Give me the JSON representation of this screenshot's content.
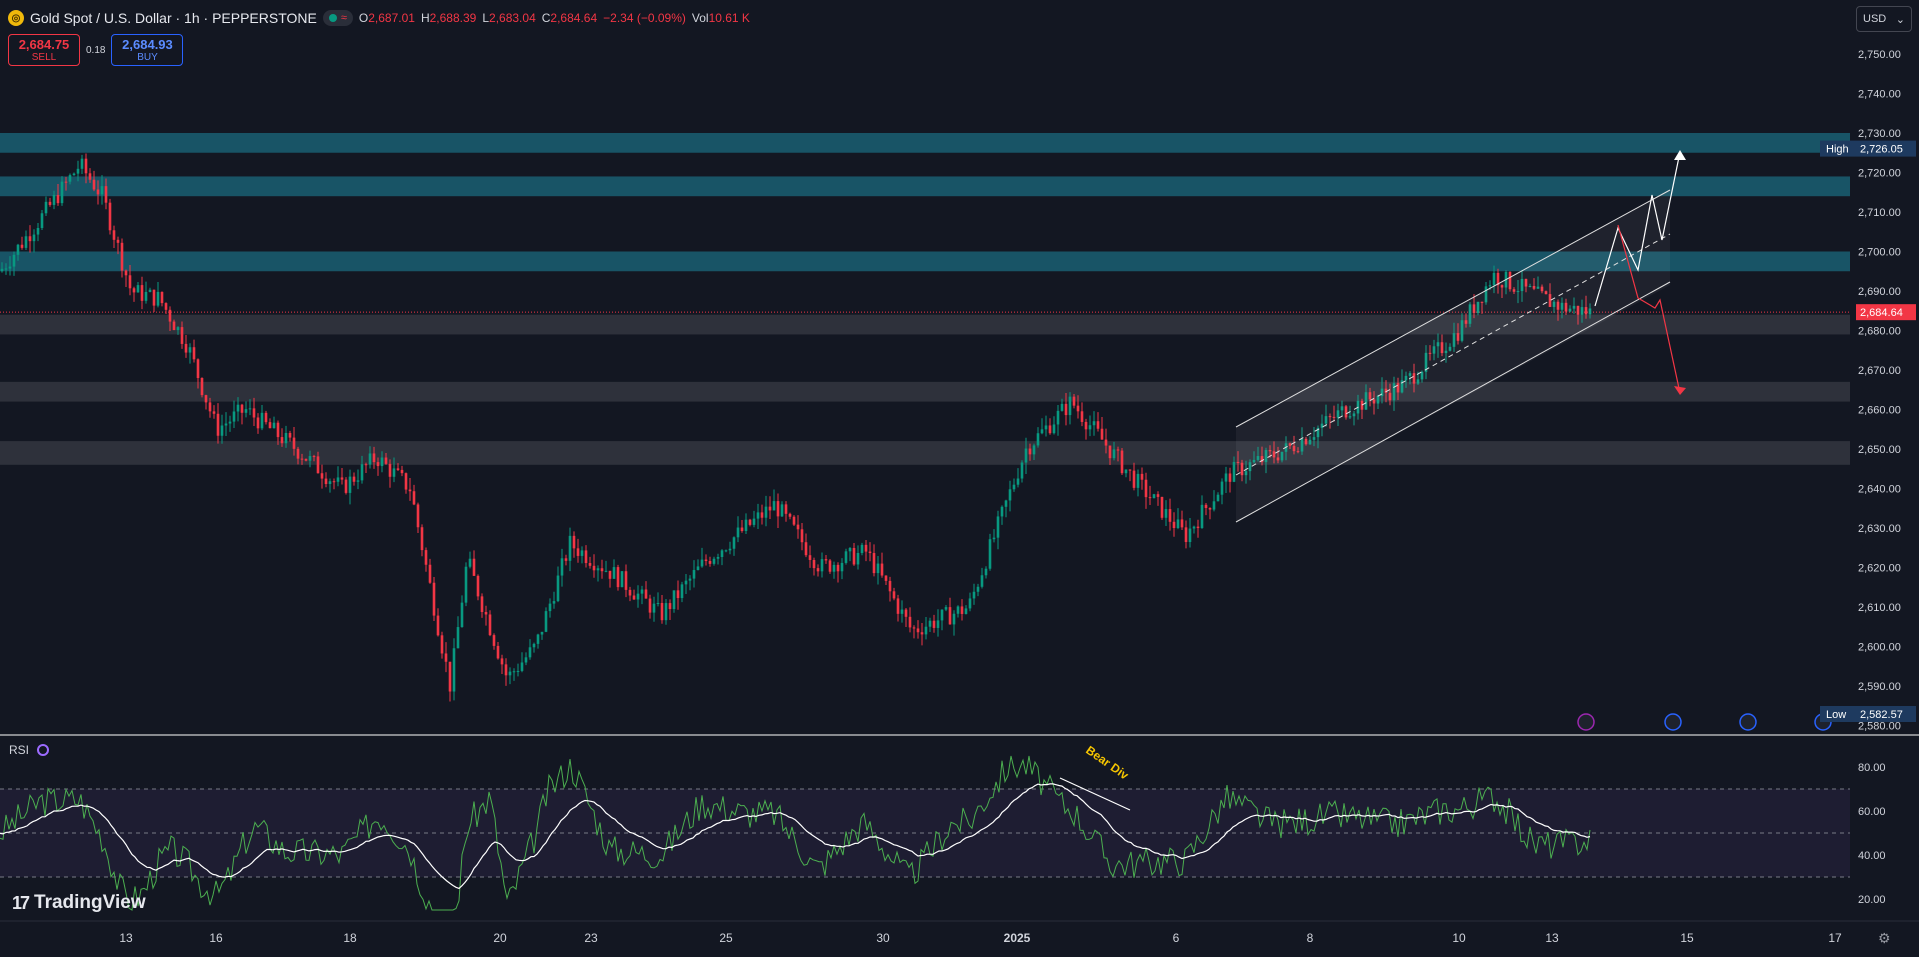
{
  "header": {
    "symbol_icon": "gold-coin-icon",
    "title": "Gold Spot / U.S. Dollar · 1h · PEPPERSTONE",
    "status_icon": "market-open-dot-icon",
    "wave_icon": "≈",
    "open_label": "O",
    "open": "2,687.01",
    "high_label": "H",
    "high": "2,688.39",
    "low_label": "L",
    "low": "2,683.04",
    "close_label": "C",
    "close": "2,684.64",
    "change": "−2.34 (−0.09%)",
    "vol_label": "Vol",
    "vol": "10.61 K"
  },
  "trade": {
    "sell_price": "2,684.75",
    "sell_label": "SELL",
    "spread": "0.18",
    "buy_price": "2,684.93",
    "buy_label": "BUY"
  },
  "currency": {
    "selected": "USD"
  },
  "price_axis": {
    "ticks": [
      "2,750.00",
      "2,740.00",
      "2,730.00",
      "2,720.00",
      "2,710.00",
      "2,700.00",
      "2,690.00",
      "2,680.00",
      "2,670.00",
      "2,660.00",
      "2,650.00",
      "2,640.00",
      "2,630.00",
      "2,620.00",
      "2,610.00",
      "2,600.00",
      "2,590.00",
      "2,580.00"
    ],
    "high_label": "High",
    "high_value": "2,726.05",
    "low_label": "Low",
    "low_value": "2,582.57",
    "current_value": "2,684.64"
  },
  "time_axis": {
    "labels": [
      "13",
      "16",
      "18",
      "20",
      "23",
      "25",
      "30",
      "2025",
      "6",
      "8",
      "10",
      "13",
      "15",
      "17"
    ]
  },
  "rsi": {
    "label": "RSI",
    "ticks": [
      "80.00",
      "60.00",
      "40.00",
      "20.00"
    ],
    "annotation": "Bear Div"
  },
  "brand": {
    "name": "TradingView"
  },
  "colors": {
    "bg": "#131722",
    "up": "#089981",
    "down": "#f23645",
    "zone": "#1a5f72",
    "grey_zone": "#3a3d46"
  }
}
